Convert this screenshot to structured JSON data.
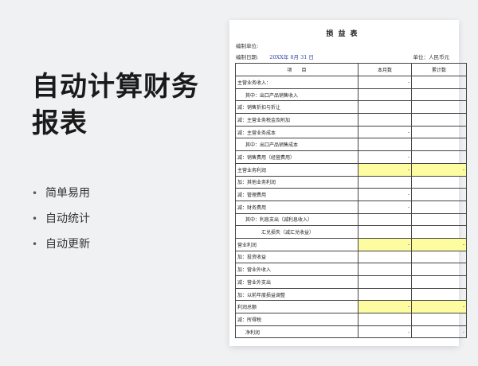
{
  "headline": "自动计算财务报表",
  "features": [
    "简单易用",
    "自动统计",
    "自动更新"
  ],
  "sheet": {
    "title": "损益表",
    "unit_label": "编制单位:",
    "date_label": "编制日期:",
    "date_value": "20XX年 8月 31 日",
    "currency_label": "单位：人民币元",
    "headers": [
      "项　　目",
      "本月数",
      "累计数"
    ],
    "rows": [
      {
        "label": "主营业务收入：",
        "month": "-",
        "total": "",
        "indent": 0,
        "highlight": false
      },
      {
        "label": "其中：出口产品销售收入",
        "month": "",
        "total": "",
        "indent": 1,
        "highlight": false
      },
      {
        "label": "减：销售折扣与折让",
        "month": "",
        "total": "",
        "indent": 0,
        "highlight": false
      },
      {
        "label": "减：主营业务税金及附加",
        "month": "",
        "total": "",
        "indent": 0,
        "highlight": false
      },
      {
        "label": "减：主营业务成本",
        "month": "-",
        "total": "",
        "indent": 0,
        "highlight": false
      },
      {
        "label": "其中：出口产品销售成本",
        "month": "",
        "total": "",
        "indent": 1,
        "highlight": false
      },
      {
        "label": "减：销售费用（经营费用）",
        "month": "-",
        "total": "",
        "indent": 0,
        "highlight": false
      },
      {
        "label": "主营业务利润",
        "month": "-",
        "total": "-",
        "indent": 0,
        "highlight": true
      },
      {
        "label": "加：其他业务利润",
        "month": "",
        "total": "",
        "indent": 0,
        "highlight": false
      },
      {
        "label": "减：管理费用",
        "month": "-",
        "total": "",
        "indent": 0,
        "highlight": false
      },
      {
        "label": "减：财务费用",
        "month": "-",
        "total": "",
        "indent": 0,
        "highlight": false
      },
      {
        "label": "其中：利息支出（减利息收入）",
        "month": "",
        "total": "",
        "indent": 1,
        "highlight": false
      },
      {
        "label": "汇兑损失（减汇兑收益）",
        "month": "",
        "total": "",
        "indent": 2,
        "highlight": false
      },
      {
        "label": "营业利润",
        "month": "-",
        "total": "-",
        "indent": 0,
        "highlight": true
      },
      {
        "label": "加：投资收益",
        "month": "",
        "total": "",
        "indent": 0,
        "highlight": false
      },
      {
        "label": "加：营业外收入",
        "month": "",
        "total": "",
        "indent": 0,
        "highlight": false
      },
      {
        "label": "减：营业外支出",
        "month": "",
        "total": "",
        "indent": 0,
        "highlight": false
      },
      {
        "label": "加：以前年度损益调整",
        "month": "",
        "total": "",
        "indent": 0,
        "highlight": false
      },
      {
        "label": "利润总额",
        "month": "-",
        "total": "-",
        "indent": 0,
        "highlight": true
      },
      {
        "label": "减：所得税",
        "month": "",
        "total": "",
        "indent": 0,
        "highlight": false
      },
      {
        "label": "净利润",
        "month": "-",
        "total": "-",
        "indent": 1,
        "highlight": false
      }
    ]
  },
  "colors": {
    "background": "#f0f1f3",
    "highlight": "#fdfca0",
    "date_text": "#3344aa"
  }
}
